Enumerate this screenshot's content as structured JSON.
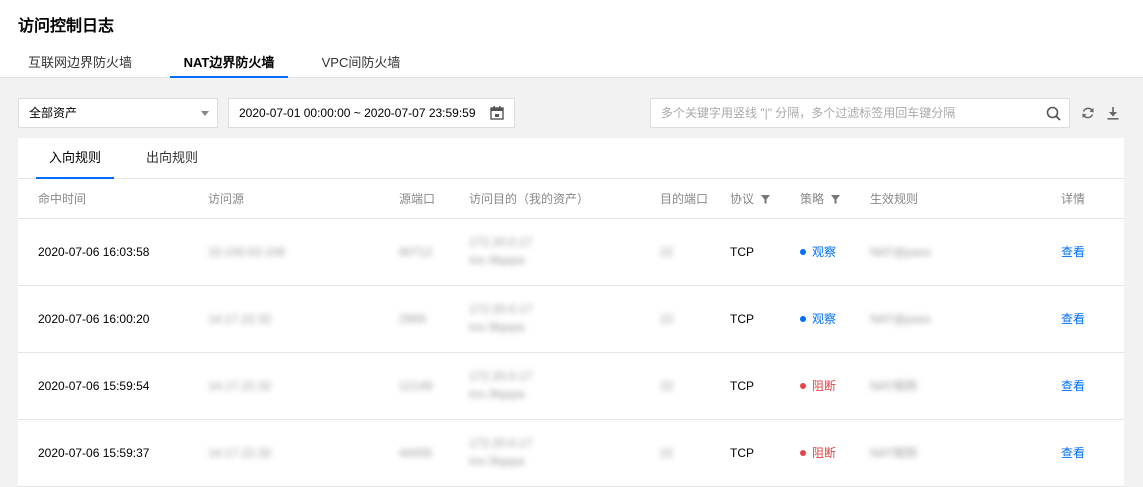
{
  "page": {
    "title": "访问控制日志"
  },
  "top_tabs": [
    {
      "label": "互联网边界防火墙",
      "active": false
    },
    {
      "label": "NAT边界防火墙",
      "active": true
    },
    {
      "label": "VPC间防火墙",
      "active": false
    }
  ],
  "filters": {
    "asset_select": "全部资产",
    "date_range": "2020-07-01 00:00:00 ~ 2020-07-07 23:59:59",
    "search_placeholder": "多个关键字用竖线 \"|\" 分隔，多个过滤标签用回车键分隔"
  },
  "sub_tabs": [
    {
      "label": "入向规则",
      "active": true
    },
    {
      "label": "出向规则",
      "active": false
    }
  ],
  "table": {
    "columns": {
      "hit_time": "命中时间",
      "source": "访问源",
      "src_port": "源端口",
      "destination": "访问目的（我的资产）",
      "dst_port": "目的端口",
      "protocol": "协议",
      "policy": "策略",
      "rule": "生效规则",
      "detail": "详情"
    },
    "rows": [
      {
        "hit_time": "2020-07-06 16:03:58",
        "source": "10.100.53.109",
        "src_port": "60712",
        "dest_ip": "172.20.0.17",
        "dest_id": "ins-3tqxpa",
        "dst_port": "22",
        "protocol": "TCP",
        "policy": "观察",
        "policy_color": "#006eff",
        "rule": "NAT@pass",
        "detail": "查看"
      },
      {
        "hit_time": "2020-07-06 16:00:20",
        "source": "14.17.22.32",
        "src_port": "2959",
        "dest_ip": "172.20.0.17",
        "dest_id": "ins-3tqxpa",
        "dst_port": "22",
        "protocol": "TCP",
        "policy": "观察",
        "policy_color": "#006eff",
        "rule": "NAT@pass",
        "detail": "查看"
      },
      {
        "hit_time": "2020-07-06 15:59:54",
        "source": "14.17.22.32",
        "src_port": "12149",
        "dest_ip": "172.20.0.17",
        "dest_id": "ins-3tqxpa",
        "dst_port": "22",
        "protocol": "TCP",
        "policy": "阻断",
        "policy_color": "#e54545",
        "rule": "NAT规则",
        "detail": "查看"
      },
      {
        "hit_time": "2020-07-06 15:59:37",
        "source": "14.17.22.32",
        "src_port": "44005",
        "dest_ip": "172.20.0.17",
        "dest_id": "ins-3tqxpa",
        "dst_port": "22",
        "protocol": "TCP",
        "policy": "阻断",
        "policy_color": "#e54545",
        "rule": "NAT规则",
        "detail": "查看"
      }
    ]
  },
  "colors": {
    "accent": "#006eff",
    "observe": "#006eff",
    "block": "#e54545"
  },
  "icons": [
    "calendar-icon",
    "search-icon",
    "refresh-icon",
    "download-icon",
    "filter-icon"
  ]
}
